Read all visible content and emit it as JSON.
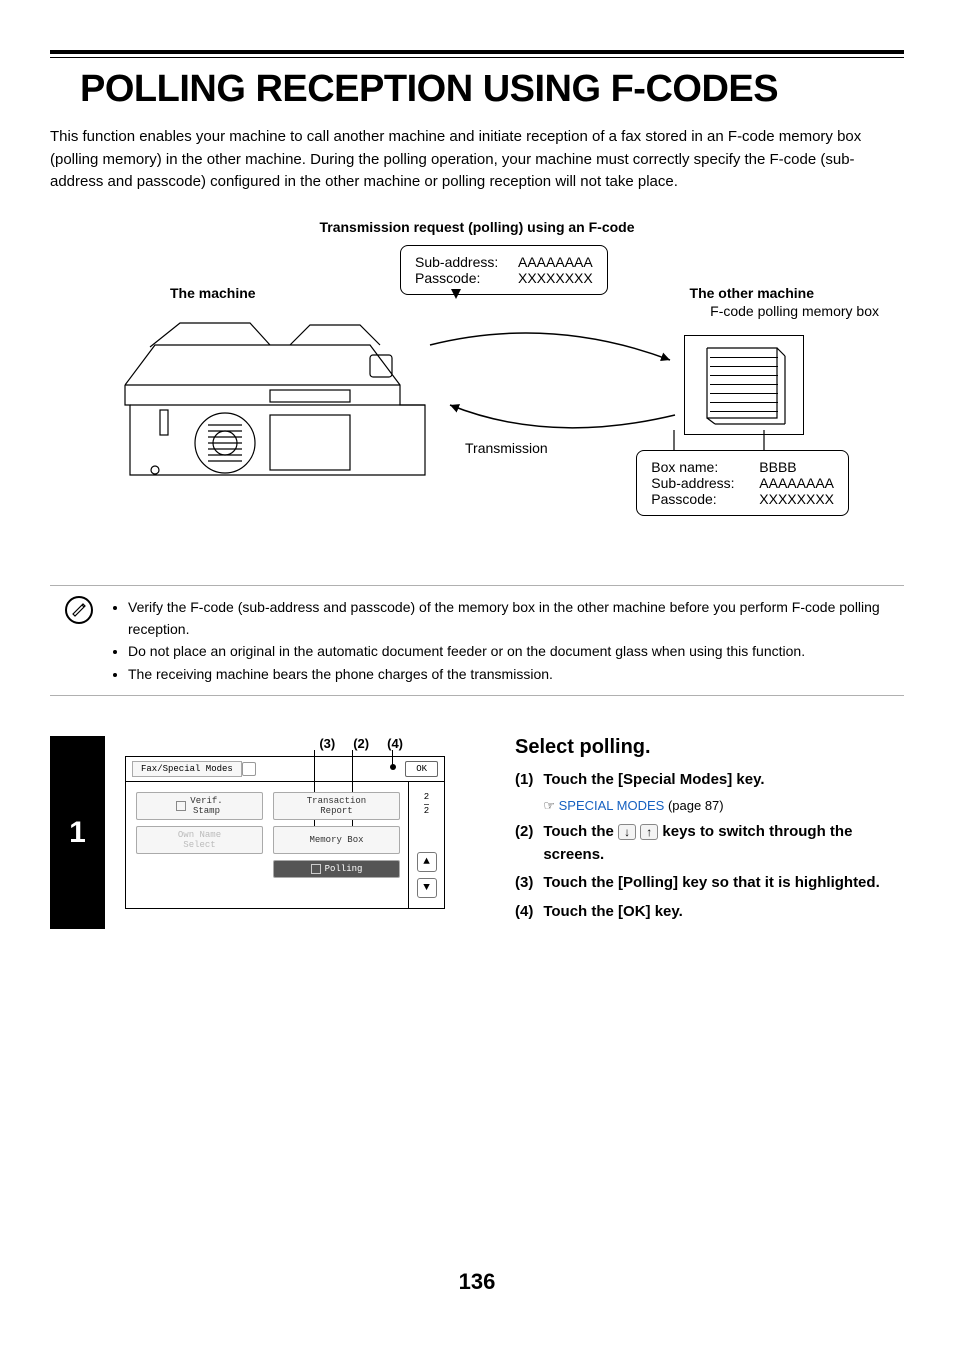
{
  "title": "POLLING RECEPTION USING F-CODES",
  "intro": "This function enables your machine to call another machine and initiate reception of a fax stored in an F-code memory box (polling memory) in the other machine. During the polling operation, your machine must correctly specify the F-code (sub-address and passcode) configured in the other machine or polling reception will not take place.",
  "diagram": {
    "caption": "Transmission request (polling) using an F-code",
    "machine_label": "The machine",
    "other_label": "The other machine",
    "other_sub": "F-code polling memory box",
    "transmission_label": "Transmission",
    "speech": {
      "subaddr_k": "Sub-address:",
      "subaddr_v": "AAAAAAAA",
      "passcode_k": "Passcode:",
      "passcode_v": "XXXXXXXX"
    },
    "receipt": {
      "box_k": "Box name:",
      "box_v": "BBBB",
      "subaddr_k": "Sub-address:",
      "subaddr_v": "AAAAAAAA",
      "passcode_k": "Passcode:",
      "passcode_v": "XXXXXXXX"
    }
  },
  "notes": {
    "n1": "Verify the F-code (sub-address and passcode) of the memory box in the other machine before you perform F-code polling reception.",
    "n2": "Do not place an original in the automatic document feeder or on the document glass when using this function.",
    "n3": "The receiving machine bears the phone charges of the transmission."
  },
  "step": {
    "number": "1",
    "callouts": {
      "c3": "(3)",
      "c2": "(2)",
      "c4": "(4)"
    },
    "screen": {
      "tab": "Fax/Special Modes",
      "ok": "OK",
      "btn_verif": "Verif.\nStamp",
      "btn_trans": "Transaction\nReport",
      "btn_ownname": "Own Name\nSelect",
      "btn_memory": "Memory Box",
      "btn_polling": "Polling",
      "page_top": "2",
      "page_bot": "2",
      "arrow_up": "▲",
      "arrow_down": "▼"
    },
    "heading": "Select polling.",
    "items": {
      "i1_num": "(1)",
      "i1_txt": "Touch the [Special Modes] key.",
      "i1_sub_prefix": "☞ ",
      "i1_sub_link": "SPECIAL MODES",
      "i1_sub_suffix": " (page 87)",
      "i2_num": "(2)",
      "i2_txt_a": "Touch the ",
      "i2_txt_b": " keys to switch through the screens.",
      "i3_num": "(3)",
      "i3_txt": "Touch the [Polling] key so that it is highlighted.",
      "i4_num": "(4)",
      "i4_txt": "Touch the [OK] key."
    }
  },
  "page_number": "136"
}
